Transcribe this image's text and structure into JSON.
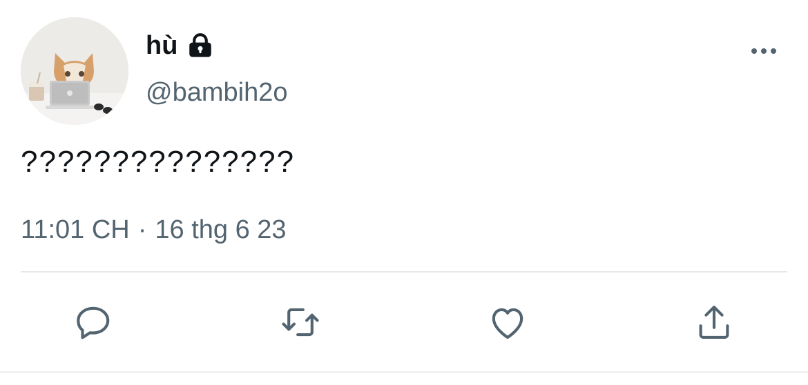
{
  "author": {
    "display_name": "hù",
    "handle": "@bambih2o",
    "protected": true
  },
  "tweet": {
    "text": "???????????????",
    "time": "11:01 CH",
    "separator": "·",
    "date": "16 thg 6 23"
  },
  "icons": {
    "lock": "lock-icon",
    "more": "more-horizontal-icon",
    "reply": "reply-icon",
    "retweet": "retweet-icon",
    "like": "heart-icon",
    "share": "share-icon"
  },
  "colors": {
    "text_primary": "#0f1419",
    "text_secondary": "#536471",
    "icon": "#536471",
    "divider": "#e6e9ec"
  }
}
